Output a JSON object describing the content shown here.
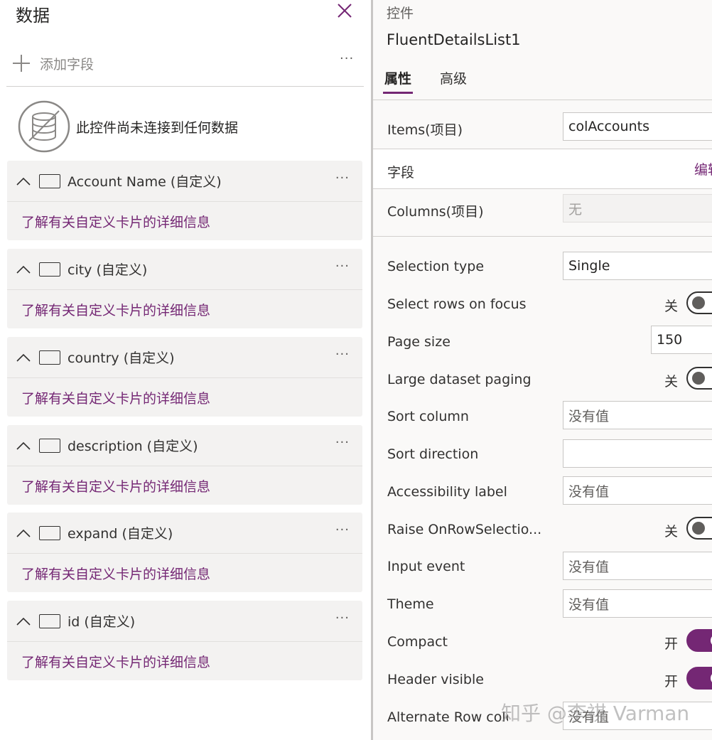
{
  "left": {
    "title": "数据",
    "add_field": "添加字段",
    "more": "···",
    "no_data_text": "此控件尚未连接到任何数据",
    "cards": [
      {
        "name": "Account Name (自定义)",
        "link": "了解有关自定义卡片的详细信息"
      },
      {
        "name": "city (自定义)",
        "link": "了解有关自定义卡片的详细信息"
      },
      {
        "name": "country (自定义)",
        "link": "了解有关自定义卡片的详细信息"
      },
      {
        "name": "description (自定义)",
        "link": "了解有关自定义卡片的详细信息"
      },
      {
        "name": "expand (自定义)",
        "link": "了解有关自定义卡片的详细信息"
      },
      {
        "name": "id (自定义)",
        "link": "了解有关自定义卡片的详细信息"
      }
    ]
  },
  "right": {
    "section": "控件",
    "control_name": "FluentDetailsList1",
    "tabs": [
      "属性",
      "高级"
    ],
    "items_label": "Items(项目)",
    "items_value": "colAccounts",
    "fields_label": "字段",
    "fields_edit": "编辑",
    "columns_label": "Columns(项目)",
    "columns_value": "无",
    "selection_type_label": "Selection type",
    "selection_type_value": "Single",
    "select_rows_label": "Select rows on focus",
    "select_rows_state": "关",
    "page_size_label": "Page size",
    "page_size_value": "150",
    "large_paging_label": "Large dataset paging",
    "large_paging_state": "关",
    "sort_column_label": "Sort column",
    "sort_column_value": "没有值",
    "sort_direction_label": "Sort direction",
    "sort_direction_value": "",
    "accessibility_label": "Accessibility label",
    "accessibility_value": "没有值",
    "raise_label": "Raise OnRowSelectio...",
    "raise_state": "关",
    "input_event_label": "Input event",
    "input_event_value": "没有值",
    "theme_label": "Theme",
    "theme_value": "没有值",
    "compact_label": "Compact",
    "compact_state": "开",
    "header_visible_label": "Header visible",
    "header_visible_state": "开",
    "alt_row_label": "Alternate Row color",
    "alt_row_value": "没有值"
  },
  "watermark": "知乎 @李祺 Varman",
  "colors": {
    "accent": "#742774",
    "panel": "#faf9f8",
    "card": "#f3f2f1"
  }
}
